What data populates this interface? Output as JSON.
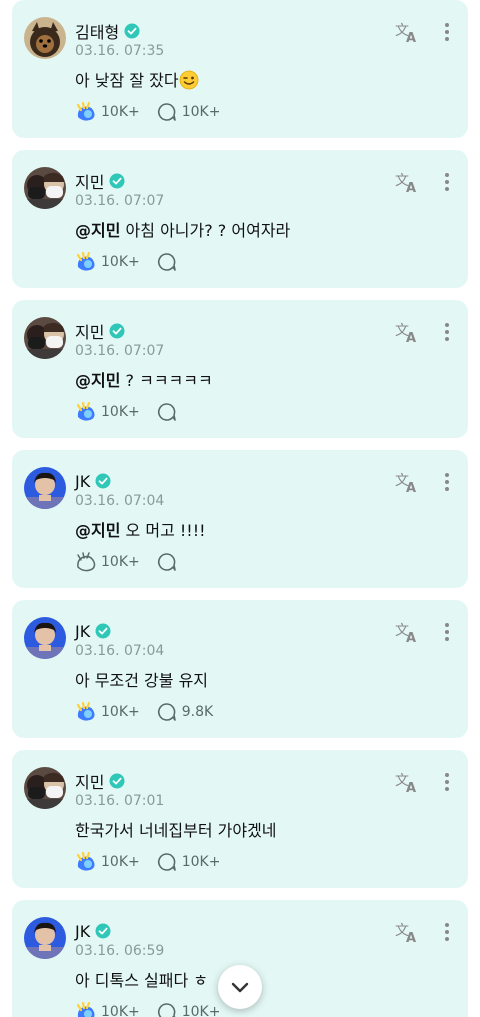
{
  "posts": [
    {
      "author": "김태형",
      "avatar": "pomeranian-avatar",
      "time": "03.16. 07:35",
      "mention": "",
      "text": "아 낮잠 잘 잤다",
      "emoji": "wink-emoji",
      "likes": "10K+",
      "comments": "10K+",
      "liked": true
    },
    {
      "author": "지민",
      "avatar": "masked-duo-avatar",
      "time": "03.16. 07:07",
      "mention": "@지민",
      "text": " 아침 아니가? ?  어여자라",
      "emoji": "",
      "likes": "10K+",
      "comments": "",
      "liked": true
    },
    {
      "author": "지민",
      "avatar": "masked-duo-avatar",
      "time": "03.16. 07:07",
      "mention": "@지민",
      "text": " ? ㅋㅋㅋㅋㅋ",
      "emoji": "",
      "likes": "10K+",
      "comments": "",
      "liked": true
    },
    {
      "author": "JK",
      "avatar": "jk-avatar",
      "time": "03.16. 07:04",
      "mention": "@지민",
      "text": " 오 머고 !!!!",
      "emoji": "",
      "likes": "10K+",
      "comments": "",
      "liked": false
    },
    {
      "author": "JK",
      "avatar": "jk-avatar",
      "time": "03.16. 07:04",
      "mention": "",
      "text": "아 무조건 강불 유지",
      "emoji": "",
      "likes": "10K+",
      "comments": "9.8K",
      "liked": true
    },
    {
      "author": "지민",
      "avatar": "masked-duo-avatar",
      "time": "03.16. 07:01",
      "mention": "",
      "text": "한국가서 너네집부터 가야겠네",
      "emoji": "",
      "likes": "10K+",
      "comments": "10K+",
      "liked": true
    },
    {
      "author": "JK",
      "avatar": "jk-avatar",
      "time": "03.16. 06:59",
      "mention": "",
      "text": "아 디톡스 실패다 ㅎ",
      "emoji": "",
      "likes": "10K+",
      "comments": "10K+",
      "liked": true
    }
  ],
  "icons": {
    "verified": "verified-badge-icon",
    "translate": "translate-icon",
    "more": "more-options-icon",
    "like": "like-icon",
    "comment": "comment-icon",
    "scroll": "chevron-down-icon"
  },
  "colors": {
    "card_background": "#e3f8f5",
    "verified": "#2fc7b8",
    "like_blue": "#3d7cff",
    "like_yellow": "#ffd23a",
    "muted_text": "#8a9a97"
  }
}
